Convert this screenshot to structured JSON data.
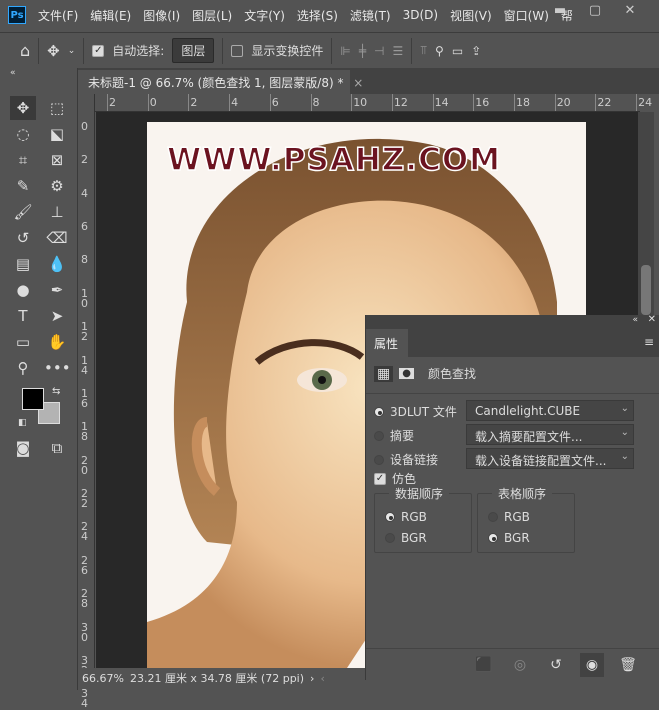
{
  "app": {
    "logo": "Ps",
    "menu": [
      "文件(F)",
      "编辑(E)",
      "图像(I)",
      "图层(L)",
      "文字(Y)",
      "选择(S)",
      "滤镜(T)",
      "3D(D)",
      "视图(V)",
      "窗口(W)",
      "帮"
    ],
    "window_controls": [
      "minimize-icon",
      "maximize-icon",
      "close-icon"
    ]
  },
  "options": {
    "auto_select_label": "自动选择:",
    "auto_select_checked": true,
    "target_value": "图层",
    "show_transform_label": "显示变换控件",
    "show_transform_checked": false
  },
  "document": {
    "tab_title": "未标题-1 @ 66.7% (颜色查找 1, 图层蒙版/8) *",
    "watermark": "WWW.PSAHZ.COM"
  },
  "rulers": {
    "h": [
      "2",
      "0",
      "2",
      "4",
      "6",
      "8",
      "10",
      "12",
      "14",
      "16",
      "18",
      "20",
      "22",
      "24"
    ],
    "v": [
      "0",
      "2",
      "4",
      "6",
      "8",
      "1\n0",
      "1\n2",
      "1\n4",
      "1\n6",
      "1\n8",
      "2\n0",
      "2\n2",
      "2\n4",
      "2\n6",
      "2\n8",
      "3\n0",
      "3\n2",
      "3\n4"
    ]
  },
  "status": {
    "zoom": "66.67%",
    "size": "23.21 厘米 x 34.78 厘米 (72 ppi)",
    "arrow": "›",
    "left_arrow": "‹"
  },
  "properties": {
    "tab": "属性",
    "title": "颜色查找",
    "options": [
      {
        "label": "3DLUT 文件",
        "selected": true,
        "value": "Candlelight.CUBE"
      },
      {
        "label": "摘要",
        "selected": false,
        "value": "载入摘要配置文件..."
      },
      {
        "label": "设备链接",
        "selected": false,
        "value": "载入设备链接配置文件..."
      }
    ],
    "dither_label": "仿色",
    "dither_checked": true,
    "data_order": {
      "title": "数据顺序",
      "options": [
        "RGB",
        "BGR"
      ],
      "selected": "RGB"
    },
    "table_order": {
      "title": "表格顺序",
      "options": [
        "RGB",
        "BGR"
      ],
      "selected": "BGR"
    }
  },
  "colors": {
    "foreground": "#000000",
    "background": "#b3b3b3",
    "accent": "#31a8ff"
  }
}
